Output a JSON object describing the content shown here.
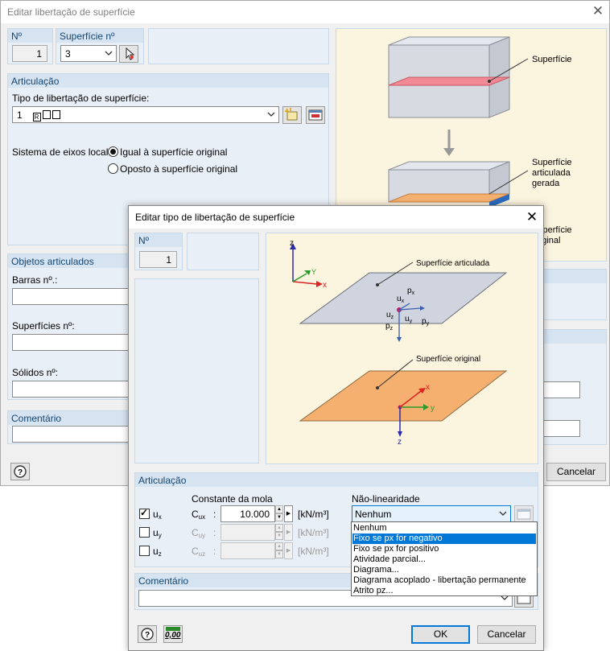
{
  "main_dialog": {
    "title": "Editar libertação de superfície",
    "no_label": "Nº",
    "no_value": "1",
    "surface_no_label": "Superfície nº",
    "surface_no_value": "3",
    "articulation_title": "Articulação",
    "release_type_label": "Tipo de libertação de superfície:",
    "release_type_value": "1",
    "axes_label": "Sistema de eixos local:",
    "axes_options": [
      "Igual à superfície original",
      "Oposto à superfície original"
    ],
    "articulated_objects_title": "Objetos articulados",
    "bars_label": "Barras nº.:",
    "surfaces_label": "Superfícies nº:",
    "solids_label": "Sólidos nº:",
    "comment_title": "Comentário",
    "cancel_label": "Cancelar",
    "fig_labels": {
      "surface": "Superfície",
      "generated_line1": "Superfície",
      "generated_line2": "articulada",
      "generated_line3": "gerada",
      "original_line1": "Superfície",
      "original_line2": "original"
    }
  },
  "child_dialog": {
    "title": "Editar tipo de libertação de superfície",
    "no_label": "Nº",
    "no_value": "1",
    "fig": {
      "articulated_label": "Superfície articulada",
      "original_label": "Superfície original",
      "axis_z": "z",
      "axis_y": "Y",
      "axis_x": "x",
      "ux": "u",
      "uy": "u",
      "uz": "u",
      "px": "p",
      "py": "p",
      "pz": "p",
      "sub_x": "x",
      "sub_y": "y",
      "sub_z": "z"
    },
    "articulation_title": "Articulação",
    "spring_constant_header": "Constante da mola",
    "nonlinearity_header": "Não-linearidade",
    "rows": [
      {
        "check_label": "u",
        "sub": "x",
        "c_label": "C",
        "c_sub": "ux",
        "value": "10.000",
        "unit": "[kN/m³]",
        "checked": true
      },
      {
        "check_label": "u",
        "sub": "y",
        "c_label": "C",
        "c_sub": "uy",
        "value": "",
        "unit": "[kN/m³]",
        "checked": false
      },
      {
        "check_label": "u",
        "sub": "z",
        "c_label": "C",
        "c_sub": "uz",
        "value": "",
        "unit": "[kN/m³]",
        "checked": false
      }
    ],
    "colon": ":",
    "nonlinearity_value": "Nenhum",
    "dropdown_options": [
      "Nenhum",
      "Fixo se px for negativo",
      "Fixo se px for positivo",
      "Atividade parcial...",
      "Diagrama...",
      "Diagrama acoplado - libertação permanente",
      "Atrito pz..."
    ],
    "selected_option_index": 1,
    "comment_title": "Comentário",
    "ok_label": "OK",
    "cancel_label": "Cancelar",
    "units_icon_text": "0,00"
  },
  "colors": {
    "accent": "#0078d7",
    "group_header": "#d6e4f2",
    "group_bg": "#e9eff6",
    "group_title": "#14456e",
    "fig_bg": "#fbf4df",
    "orange_surface": "#f5b070",
    "gray_surface": "#cfd4de"
  }
}
